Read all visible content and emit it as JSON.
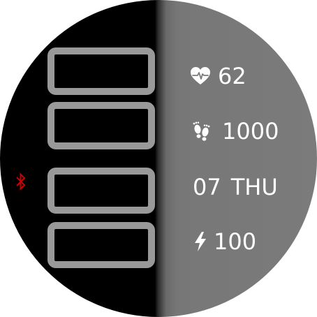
{
  "colors": {
    "left_bg": "#000000",
    "right_bg": "#7b7b7b",
    "slot_border": "#999999",
    "bluetooth": "#cc0000",
    "text": "#ffffff"
  },
  "icons": {
    "heart": "heart-rate-icon",
    "steps": "footsteps-icon",
    "battery": "lightning-bolt-icon",
    "bluetooth": "bluetooth-icon"
  },
  "stats": {
    "heart_rate": "62",
    "steps": "1000",
    "date_day": "07",
    "date_weekday": "THU",
    "battery": "100"
  }
}
